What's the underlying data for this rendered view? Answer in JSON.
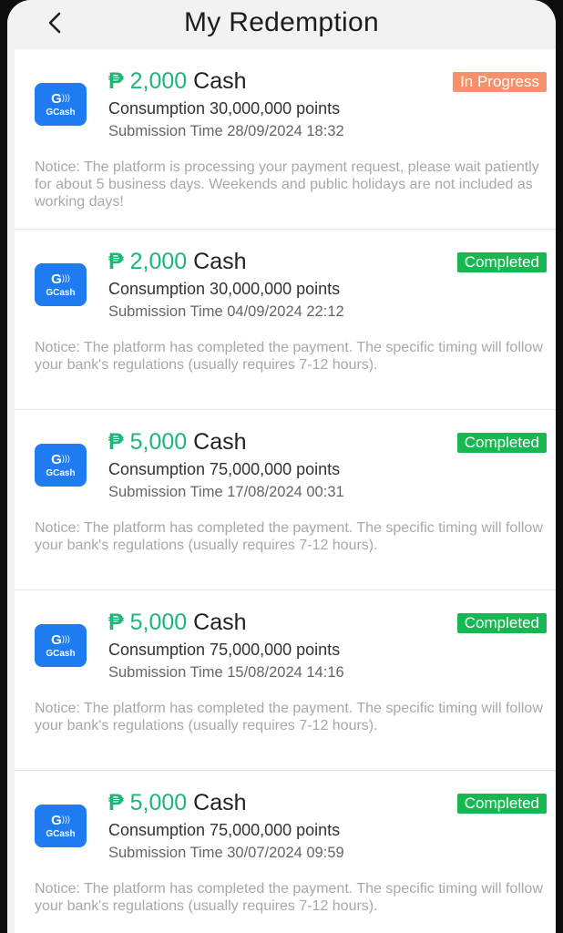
{
  "header": {
    "title": "My Redemption",
    "back_icon": "chevron-left-icon"
  },
  "colors": {
    "cash_green": "#1db676",
    "in_progress": "#f6916b",
    "completed": "#17b752",
    "gcash_blue": "#1e7bf0",
    "notice_gray": "#a8a8a8"
  },
  "logo": {
    "brand_mark": "G",
    "brand_name": "GCash"
  },
  "redemptions": [
    {
      "currency_symbol": "₱",
      "amount": "2,000",
      "unit": "Cash",
      "status": "In Progress",
      "status_color": "#f6916b",
      "consumption": "Consumption 30,000,000 points",
      "submission_time": "Submission Time 28/09/2024 18:32",
      "notice": "Notice: The platform is processing your payment request, please wait patiently for about 5 business days. Weekends and public holidays are not included as working days!"
    },
    {
      "currency_symbol": "₱",
      "amount": "2,000",
      "unit": "Cash",
      "status": "Completed",
      "status_color": "#17b752",
      "consumption": "Consumption 30,000,000 points",
      "submission_time": "Submission Time 04/09/2024 22:12",
      "notice": "Notice: The platform has completed the payment. The specific timing will follow your bank's regulations (usually requires 7-12 hours)."
    },
    {
      "currency_symbol": "₱",
      "amount": "5,000",
      "unit": "Cash",
      "status": "Completed",
      "status_color": "#17b752",
      "consumption": "Consumption 75,000,000 points",
      "submission_time": "Submission Time 17/08/2024 00:31",
      "notice": "Notice: The platform has completed the payment. The specific timing will follow your bank's regulations (usually requires 7-12 hours)."
    },
    {
      "currency_symbol": "₱",
      "amount": "5,000",
      "unit": "Cash",
      "status": "Completed",
      "status_color": "#17b752",
      "consumption": "Consumption 75,000,000 points",
      "submission_time": "Submission Time 15/08/2024 14:16",
      "notice": "Notice: The platform has completed the payment. The specific timing will follow your bank's regulations (usually requires 7-12 hours)."
    },
    {
      "currency_symbol": "₱",
      "amount": "5,000",
      "unit": "Cash",
      "status": "Completed",
      "status_color": "#17b752",
      "consumption": "Consumption 75,000,000 points",
      "submission_time": "Submission Time 30/07/2024 09:59",
      "notice": "Notice: The platform has completed the payment. The specific timing will follow your bank's regulations (usually requires 7-12 hours)."
    }
  ]
}
